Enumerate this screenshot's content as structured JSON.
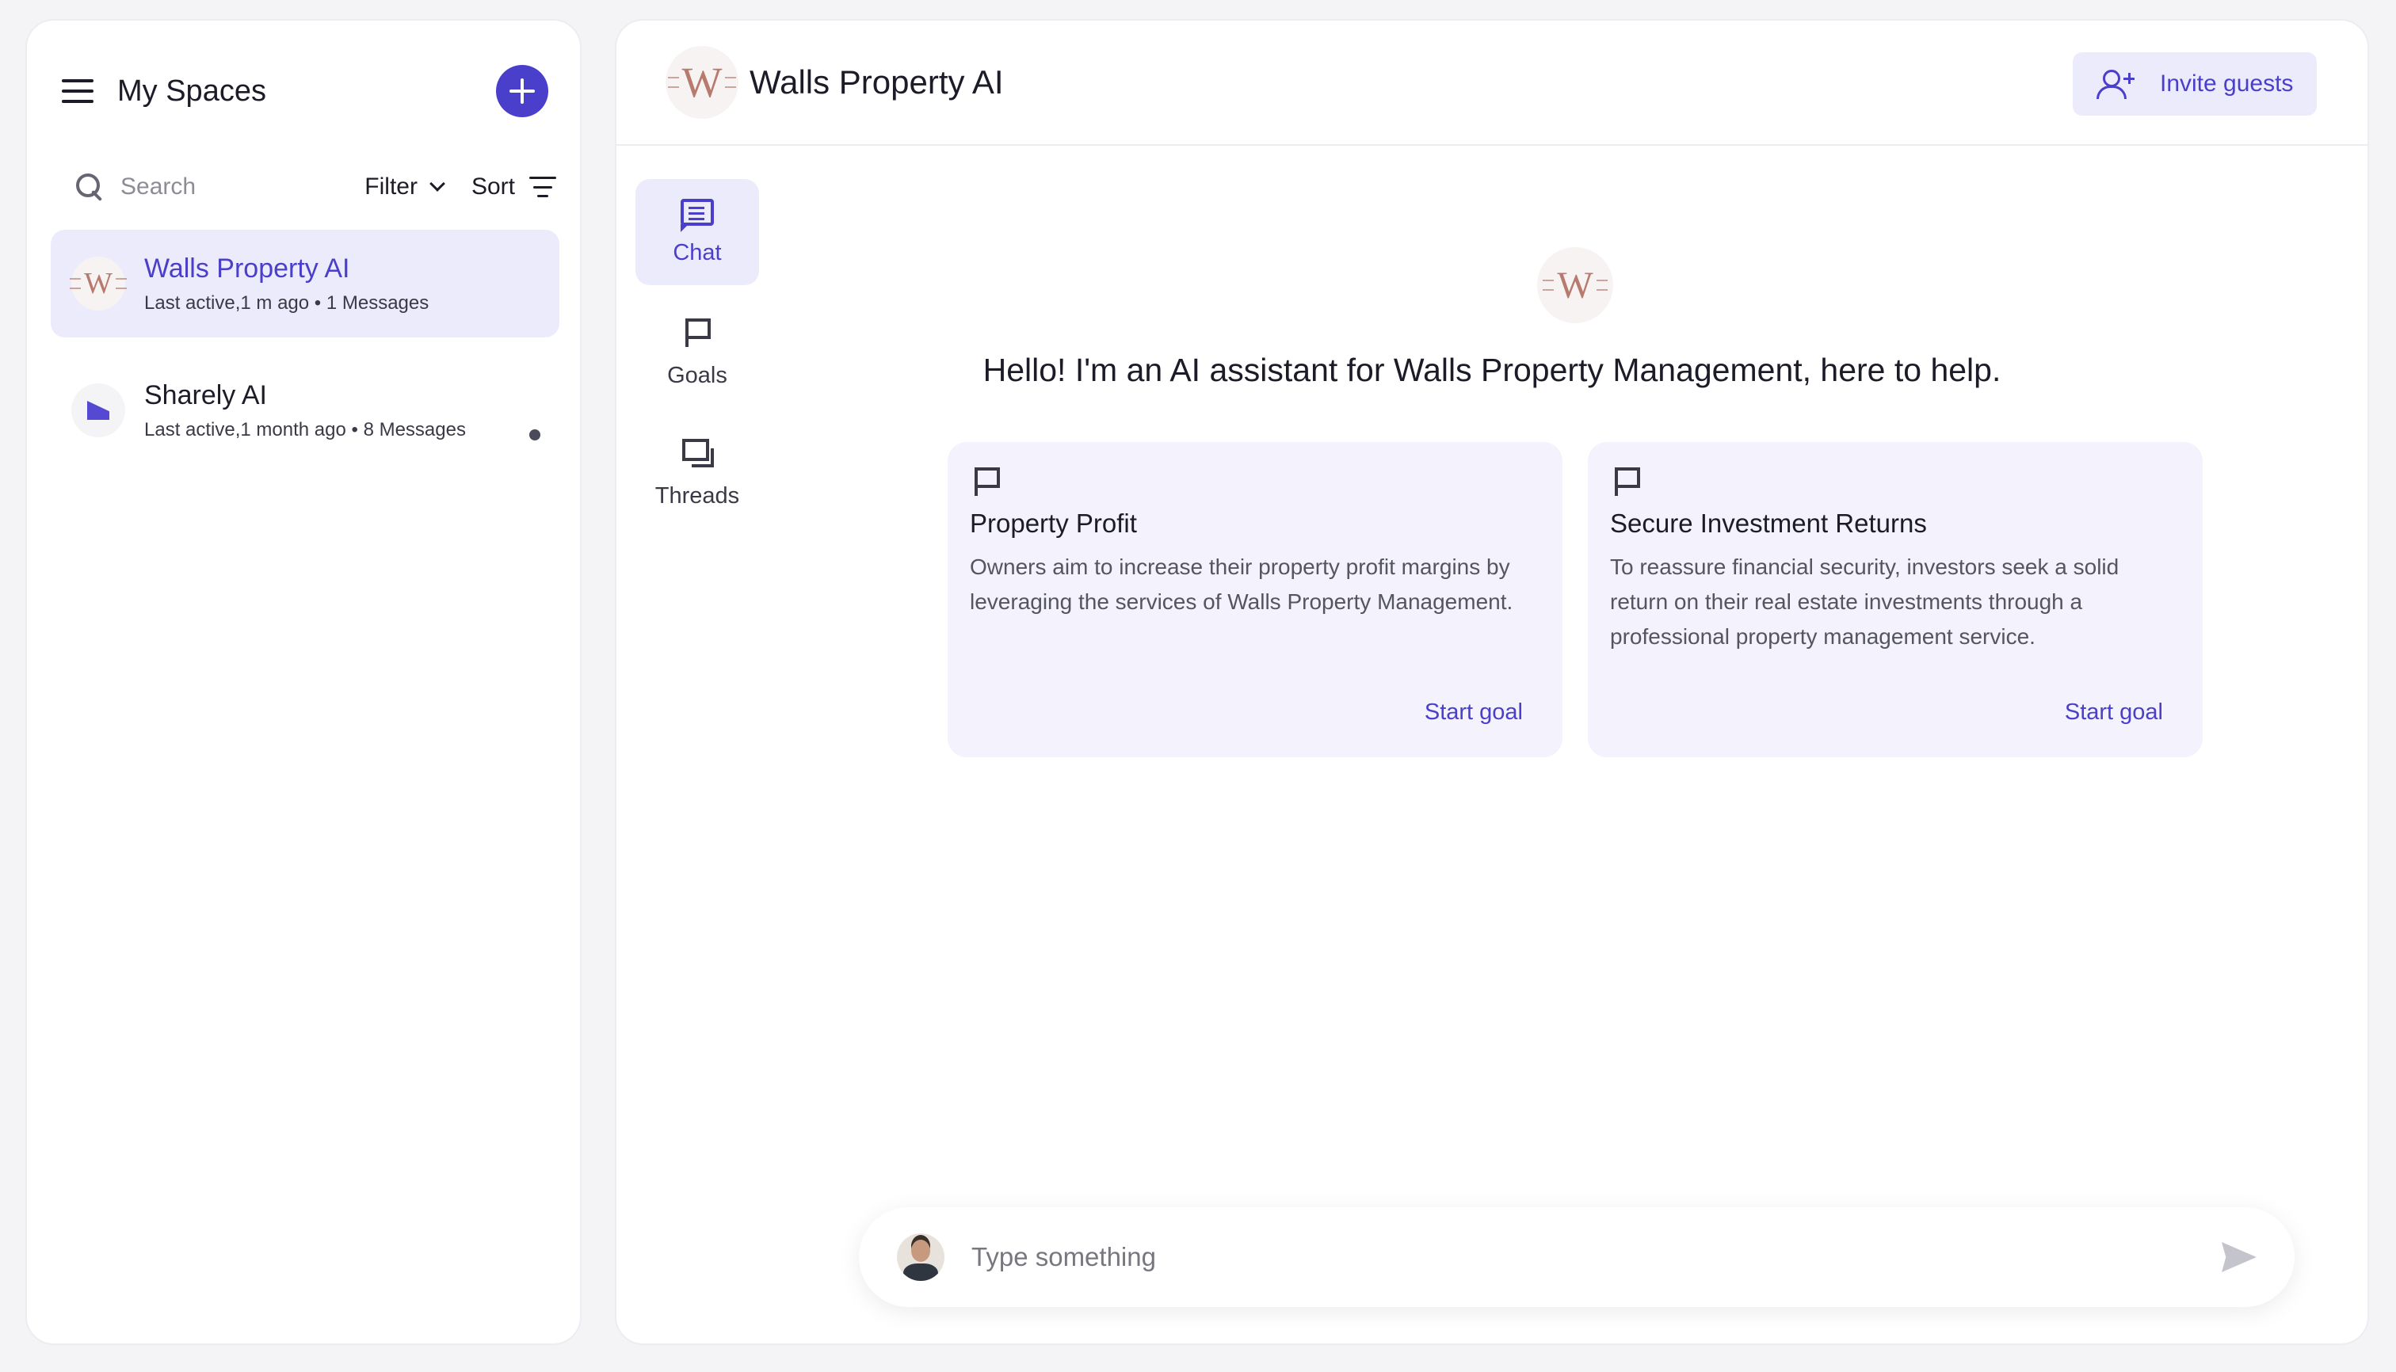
{
  "sidebar": {
    "title": "My Spaces",
    "search_placeholder": "Search",
    "filter_label": "Filter",
    "sort_label": "Sort",
    "spaces": [
      {
        "name": "Walls Property AI",
        "meta": "Last active,1 m ago • 1 Messages",
        "active": true
      },
      {
        "name": "Sharely AI",
        "meta": "Last active,1 month ago • 8 Messages",
        "active": false
      }
    ]
  },
  "header": {
    "title": "Walls Property AI",
    "invite_label": "Invite guests"
  },
  "nav": {
    "items": [
      {
        "label": "Chat",
        "icon": "chat-icon"
      },
      {
        "label": "Goals",
        "icon": "flag-icon"
      },
      {
        "label": "Threads",
        "icon": "threads-icon"
      }
    ]
  },
  "main": {
    "greeting": "Hello! I'm an AI assistant for Walls Property Management, here to help.",
    "goals": [
      {
        "title": "Property Profit",
        "description": "Owners aim to increase their property profit margins by leveraging the services of Walls Property Management.",
        "action": "Start goal"
      },
      {
        "title": "Secure Investment Returns",
        "description": "To reassure financial security, investors seek a solid return on their real estate investments through a professional property management service.",
        "action": "Start goal"
      }
    ]
  },
  "composer": {
    "placeholder": "Type something"
  },
  "logo_text": "W",
  "colors": {
    "accent": "#4a3fcb",
    "accent_light": "#ecebfb",
    "card_bg": "#f3f2fd"
  }
}
